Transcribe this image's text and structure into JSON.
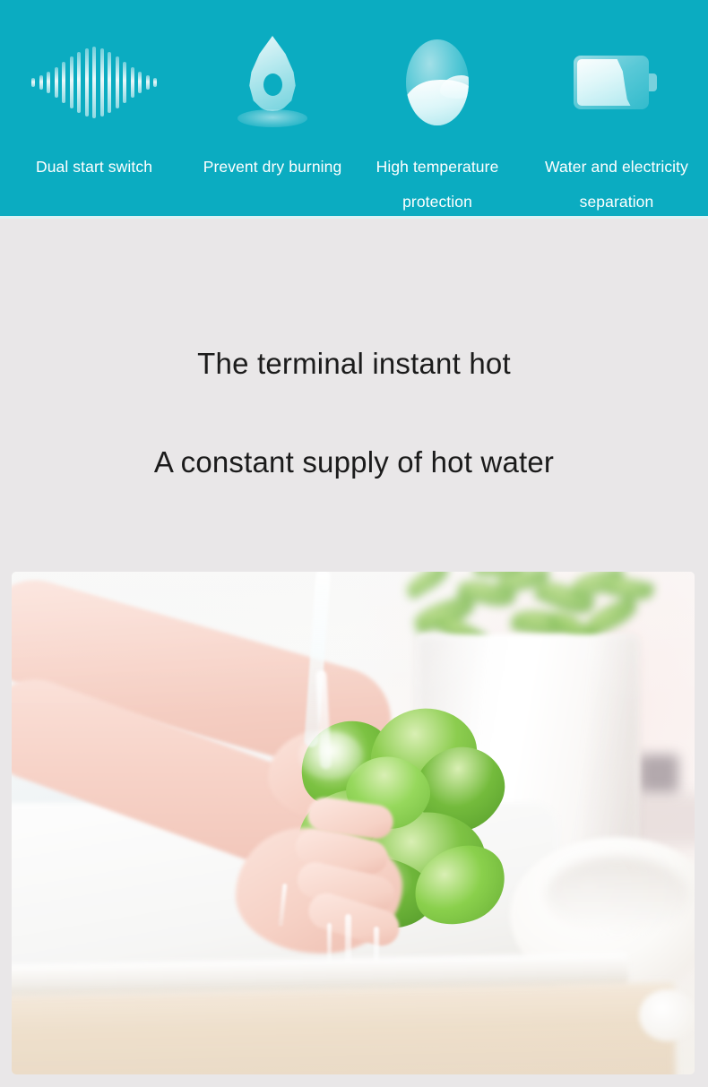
{
  "colors": {
    "band_teal": "#0bacc1",
    "band_underline": "#ddf3f5",
    "page_background": "#e9e7e8",
    "headline_text": "#1b1b1b",
    "label_text": "#ffffff"
  },
  "feature_band": {
    "items": [
      {
        "icon": "sound-wave-icon",
        "label": "Dual start switch"
      },
      {
        "icon": "water-drop-icon",
        "label": "Prevent dry burning"
      },
      {
        "icon": "temperature-wave-icon",
        "label": "High temperature\nprotection"
      },
      {
        "icon": "battery-separation-icon",
        "label": "Water and electricity\nseparation"
      }
    ]
  },
  "headline": {
    "line1": "The terminal instant hot",
    "line2": "A constant supply of hot water"
  },
  "photo": {
    "name": "washing-lettuce-under-running-water",
    "scene_elements": [
      "hands washing green lettuce",
      "running water stream from tap",
      "white sink basin",
      "wooden countertop edge",
      "blurred white plant pot with green plant",
      "white bowl at right",
      "wall outlet"
    ]
  },
  "icon_bars": {
    "sound_wave_heights": [
      10,
      16,
      24,
      34,
      46,
      58,
      68,
      76,
      80,
      76,
      68,
      58,
      46,
      34,
      24,
      16,
      10
    ]
  }
}
